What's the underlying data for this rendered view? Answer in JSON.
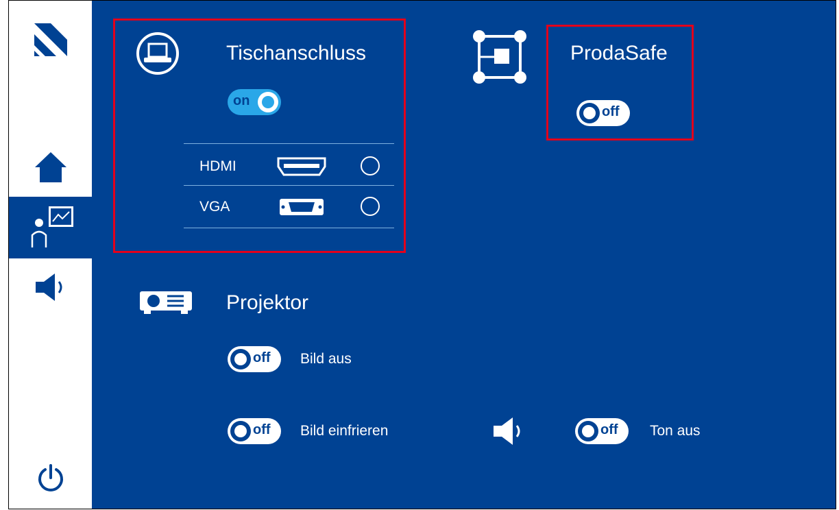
{
  "colors": {
    "main_bg": "#004293",
    "accent": "#2aa7e8",
    "highlight_border": "#e3001b",
    "sidebar_bg": "#ffffff"
  },
  "sidebar": {
    "items": [
      {
        "icon": "brand-logo-icon"
      },
      {
        "icon": "home-icon"
      },
      {
        "icon": "presenter-icon",
        "active": true
      },
      {
        "icon": "speaker-icon"
      },
      {
        "icon": "power-icon"
      }
    ]
  },
  "table_connection": {
    "title": "Tischanschluss",
    "icon": "laptop-icon",
    "toggle": {
      "state": "on",
      "label": "on"
    },
    "inputs": [
      {
        "label": "HDMI",
        "icon": "hdmi-port-icon"
      },
      {
        "label": "VGA",
        "icon": "vga-port-icon"
      }
    ]
  },
  "prodasafe": {
    "title": "ProdaSafe",
    "icon": "screen-share-icon",
    "toggle": {
      "state": "off",
      "label": "off"
    }
  },
  "projector": {
    "title": "Projektor",
    "icon": "projector-icon",
    "controls": [
      {
        "label": "Bild aus",
        "toggle": "off"
      },
      {
        "label": "Bild einfrieren",
        "toggle": "off"
      },
      {
        "label": "Ton aus",
        "toggle": "off",
        "icon": "speaker-icon"
      }
    ],
    "toggle_label_off": "off"
  }
}
